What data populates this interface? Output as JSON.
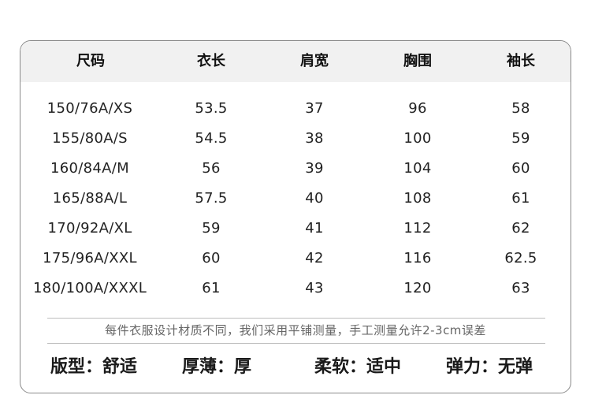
{
  "table": {
    "headers": [
      "尺码",
      "衣长",
      "肩宽",
      "胸围",
      "袖长"
    ],
    "rows": [
      [
        "150/76A/XS",
        "53.5",
        "37",
        "96",
        "58"
      ],
      [
        "155/80A/S",
        "54.5",
        "38",
        "100",
        "59"
      ],
      [
        "160/84A/M",
        "56",
        "39",
        "104",
        "60"
      ],
      [
        "165/88A/L",
        "57.5",
        "40",
        "108",
        "61"
      ],
      [
        "170/92A/XL",
        "59",
        "41",
        "112",
        "62"
      ],
      [
        "175/96A/XXL",
        "60",
        "42",
        "116",
        "62.5"
      ],
      [
        "180/100A/XXXL",
        "61",
        "43",
        "120",
        "63"
      ]
    ]
  },
  "note": "每件衣服设计材质不同，我们采用平铺测量，手工测量允许2-3cm误差",
  "attributes": [
    "版型：舒适",
    "厚薄：厚",
    "柔软：适中",
    "弹力：无弹"
  ],
  "colors": {
    "header_bg": "#f1f1f1",
    "border": "#8a8a8a",
    "text": "#222222",
    "note_text": "#666666"
  }
}
